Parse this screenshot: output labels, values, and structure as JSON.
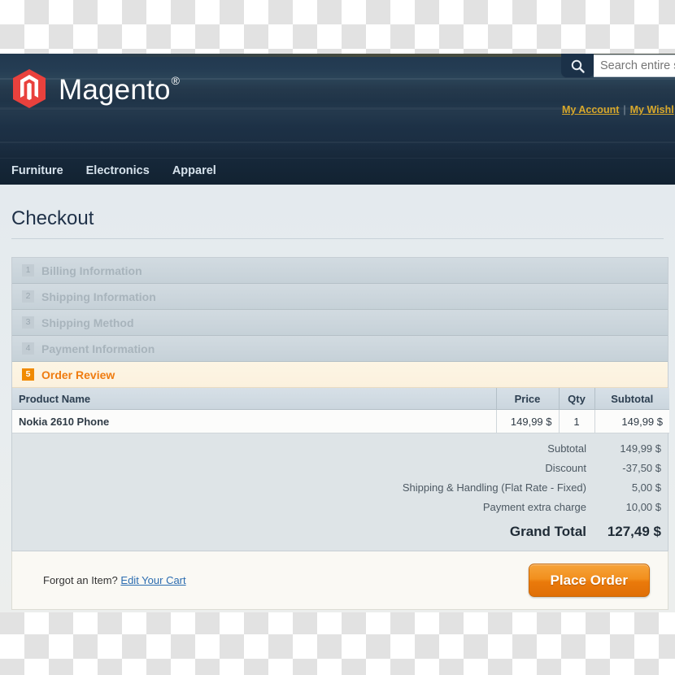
{
  "header": {
    "brand_name": "Magento",
    "brand_reg": "®",
    "logo_icon": "magento-hexagon-logo",
    "search": {
      "icon": "search-icon",
      "value": "",
      "placeholder": "Search entire s"
    },
    "account_links": [
      {
        "label": "My Account"
      },
      {
        "label": "My Wishl"
      }
    ],
    "link_separator": "|"
  },
  "nav": {
    "items": [
      {
        "label": "Furniture"
      },
      {
        "label": "Electronics"
      },
      {
        "label": "Apparel"
      }
    ]
  },
  "main": {
    "page_title": "Checkout",
    "steps": [
      {
        "number": "1",
        "label": "Billing Information",
        "active": false
      },
      {
        "number": "2",
        "label": "Shipping Information",
        "active": false
      },
      {
        "number": "3",
        "label": "Shipping Method",
        "active": false
      },
      {
        "number": "4",
        "label": "Payment Information",
        "active": false
      },
      {
        "number": "5",
        "label": "Order Review",
        "active": true
      }
    ],
    "order_table": {
      "columns": {
        "name": "Product Name",
        "price": "Price",
        "qty": "Qty",
        "subtotal": "Subtotal"
      },
      "rows": [
        {
          "name": "Nokia 2610 Phone",
          "price": "149,99 $",
          "qty": "1",
          "subtotal": "149,99 $"
        }
      ]
    },
    "totals": [
      {
        "label": "Subtotal",
        "value": "149,99 $"
      },
      {
        "label": "Discount",
        "value": "-37,50 $"
      },
      {
        "label": "Shipping & Handling (Flat Rate - Fixed)",
        "value": "5,00 $"
      },
      {
        "label": "Payment extra charge",
        "value": "10,00 $"
      }
    ],
    "grand_total": {
      "label": "Grand Total",
      "value": "127,49 $"
    },
    "actions": {
      "forgot_text": "Forgot an Item?",
      "edit_cart_label": "Edit Your Cart",
      "place_order_label": "Place Order"
    }
  },
  "colors": {
    "header_navy": "#22394f",
    "nav_navy": "#16283a",
    "accent_orange": "#f08a00",
    "link_gold": "#d8a82a",
    "link_blue": "#2b6cb0",
    "step_inactive": "#a8b4bc"
  }
}
